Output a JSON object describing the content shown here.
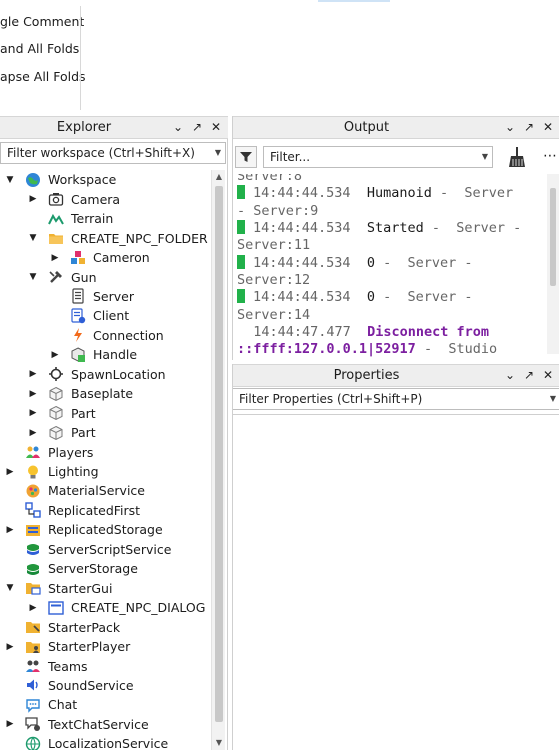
{
  "ribbon": {
    "items": [
      "gle Comment",
      "and All Folds",
      "apse All Folds"
    ]
  },
  "explorer": {
    "title": "Explorer",
    "filter_placeholder": "Filter workspace (Ctrl+Shift+X)",
    "tree": [
      {
        "label": "Workspace",
        "icon": "globe-icon",
        "depth": 0,
        "expand": "open"
      },
      {
        "label": "Camera",
        "icon": "camera-icon",
        "depth": 1,
        "expand": "closed"
      },
      {
        "label": "Terrain",
        "icon": "terrain-icon",
        "depth": 1,
        "expand": "none"
      },
      {
        "label": "CREATE_NPC_FOLDER",
        "icon": "folder-icon",
        "depth": 1,
        "expand": "open"
      },
      {
        "label": "Cameron",
        "icon": "model-icon",
        "depth": 2,
        "expand": "closed"
      },
      {
        "label": "Gun",
        "icon": "tool-icon",
        "depth": 1,
        "expand": "open"
      },
      {
        "label": "Server",
        "icon": "script-icon",
        "depth": 2,
        "expand": "none"
      },
      {
        "label": "Client",
        "icon": "local-script-icon",
        "depth": 2,
        "expand": "none"
      },
      {
        "label": "Connection",
        "icon": "remote-event-icon",
        "depth": 2,
        "expand": "none"
      },
      {
        "label": "Handle",
        "icon": "part-script-icon",
        "depth": 2,
        "expand": "closed"
      },
      {
        "label": "SpawnLocation",
        "icon": "spawn-icon",
        "depth": 1,
        "expand": "closed"
      },
      {
        "label": "Baseplate",
        "icon": "part-icon",
        "depth": 1,
        "expand": "closed"
      },
      {
        "label": "Part",
        "icon": "part-icon",
        "depth": 1,
        "expand": "closed"
      },
      {
        "label": "Part",
        "icon": "part-icon",
        "depth": 1,
        "expand": "closed"
      },
      {
        "label": "Players",
        "icon": "players-icon",
        "depth": 0,
        "expand": "none"
      },
      {
        "label": "Lighting",
        "icon": "lightbulb-icon",
        "depth": 0,
        "expand": "closed"
      },
      {
        "label": "MaterialService",
        "icon": "material-icon",
        "depth": 0,
        "expand": "none"
      },
      {
        "label": "ReplicatedFirst",
        "icon": "replicated-first-icon",
        "depth": 0,
        "expand": "none"
      },
      {
        "label": "ReplicatedStorage",
        "icon": "replicated-storage-icon",
        "depth": 0,
        "expand": "closed"
      },
      {
        "label": "ServerScriptService",
        "icon": "server-script-service-icon",
        "depth": 0,
        "expand": "none"
      },
      {
        "label": "ServerStorage",
        "icon": "server-storage-icon",
        "depth": 0,
        "expand": "none"
      },
      {
        "label": "StarterGui",
        "icon": "starter-gui-icon",
        "depth": 0,
        "expand": "open"
      },
      {
        "label": "CREATE_NPC_DIALOG",
        "icon": "screen-gui-icon",
        "depth": 1,
        "expand": "closed"
      },
      {
        "label": "StarterPack",
        "icon": "starter-pack-icon",
        "depth": 0,
        "expand": "none"
      },
      {
        "label": "StarterPlayer",
        "icon": "starter-player-icon",
        "depth": 0,
        "expand": "closed"
      },
      {
        "label": "Teams",
        "icon": "teams-icon",
        "depth": 0,
        "expand": "none"
      },
      {
        "label": "SoundService",
        "icon": "sound-icon",
        "depth": 0,
        "expand": "none"
      },
      {
        "label": "Chat",
        "icon": "chat-icon",
        "depth": 0,
        "expand": "none"
      },
      {
        "label": "TextChatService",
        "icon": "text-chat-icon",
        "depth": 0,
        "expand": "closed"
      },
      {
        "label": "LocalizationService",
        "icon": "localization-icon",
        "depth": 0,
        "expand": "none"
      }
    ]
  },
  "output": {
    "title": "Output",
    "filter_placeholder": "Filter...",
    "lines": [
      {
        "marker": false,
        "time": "",
        "msg": "",
        "suffix": "Server:8",
        "style": "cont"
      },
      {
        "marker": true,
        "time": "14:44:44.534",
        "msg": "Humanoid",
        "suffix": " -  Server",
        "style": "normal"
      },
      {
        "marker": false,
        "time": "",
        "msg": "",
        "suffix": "- Server:9",
        "style": "cont"
      },
      {
        "marker": true,
        "time": "14:44:44.534",
        "msg": "Started",
        "suffix": " -  Server -",
        "style": "normal"
      },
      {
        "marker": false,
        "time": "",
        "msg": "",
        "suffix": "Server:11",
        "style": "cont"
      },
      {
        "marker": true,
        "time": "14:44:44.534",
        "msg": "0",
        "suffix": " -  Server -",
        "style": "normal"
      },
      {
        "marker": false,
        "time": "",
        "msg": "",
        "suffix": "Server:12",
        "style": "cont"
      },
      {
        "marker": true,
        "time": "14:44:44.534",
        "msg": "0",
        "suffix": " -  Server -",
        "style": "normal"
      },
      {
        "marker": false,
        "time": "",
        "msg": "",
        "suffix": "Server:14",
        "style": "cont"
      },
      {
        "marker": false,
        "time": "  14:44:47.477",
        "msg": "Disconnect from",
        "suffix": "",
        "style": "purple"
      },
      {
        "marker": false,
        "time": "",
        "msg": "::ffff:127.0.0.1|52917",
        "suffix": " -  Studio",
        "style": "purple-cont"
      }
    ]
  },
  "properties": {
    "title": "Properties",
    "filter_placeholder": "Filter Properties (Ctrl+Shift+P)"
  },
  "colors": {
    "accent_green": "#21b14a",
    "purple_text": "#7c1fa0"
  }
}
